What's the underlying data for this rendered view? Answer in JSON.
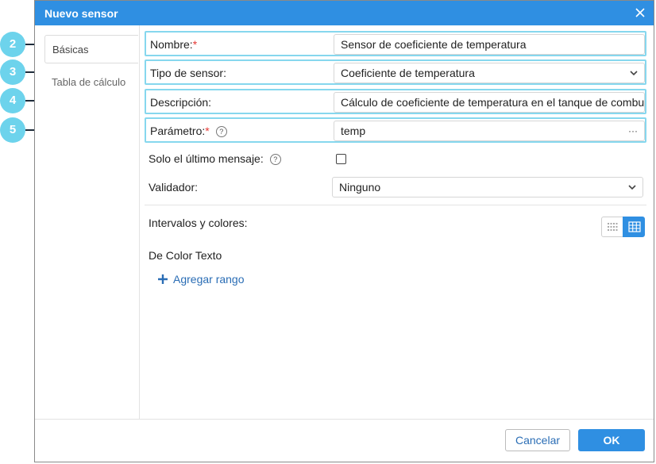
{
  "dialog": {
    "title": "Nuevo sensor",
    "close_icon": "close-icon"
  },
  "tabs": [
    {
      "label": "Básicas",
      "active": true
    },
    {
      "label": "Tabla de cálculo",
      "active": false
    }
  ],
  "form": {
    "name": {
      "label": "Nombre:",
      "required": "*",
      "value": "Sensor de coeficiente de temperatura"
    },
    "sensor_type": {
      "label": "Tipo de sensor:",
      "value": "Coeficiente de temperatura"
    },
    "description": {
      "label": "Descripción:",
      "value": "Cálculo de coeficiente de temperatura en el tanque de combu"
    },
    "parameter": {
      "label": "Parámetro:",
      "required": "*",
      "help": "?",
      "value": "temp",
      "more": "···"
    },
    "last_message_only": {
      "label": "Solo el último mensaje:",
      "help": "?",
      "checked": false
    },
    "validator": {
      "label": "Validador:",
      "value": "Ninguno"
    }
  },
  "intervals": {
    "title": "Intervalos y colores:",
    "columns": "De  Color  Texto",
    "add_range": "Agregar rango",
    "view_icons": [
      "text-view-icon",
      "table-view-icon"
    ]
  },
  "footer": {
    "cancel": "Cancelar",
    "ok": "OK"
  },
  "callouts": [
    "2",
    "3",
    "4",
    "5"
  ],
  "colors": {
    "accent": "#2f8fe2",
    "highlight": "#86d7ee",
    "callout": "#6dd3ec",
    "required": "#e53935",
    "link": "#2a6db5"
  }
}
